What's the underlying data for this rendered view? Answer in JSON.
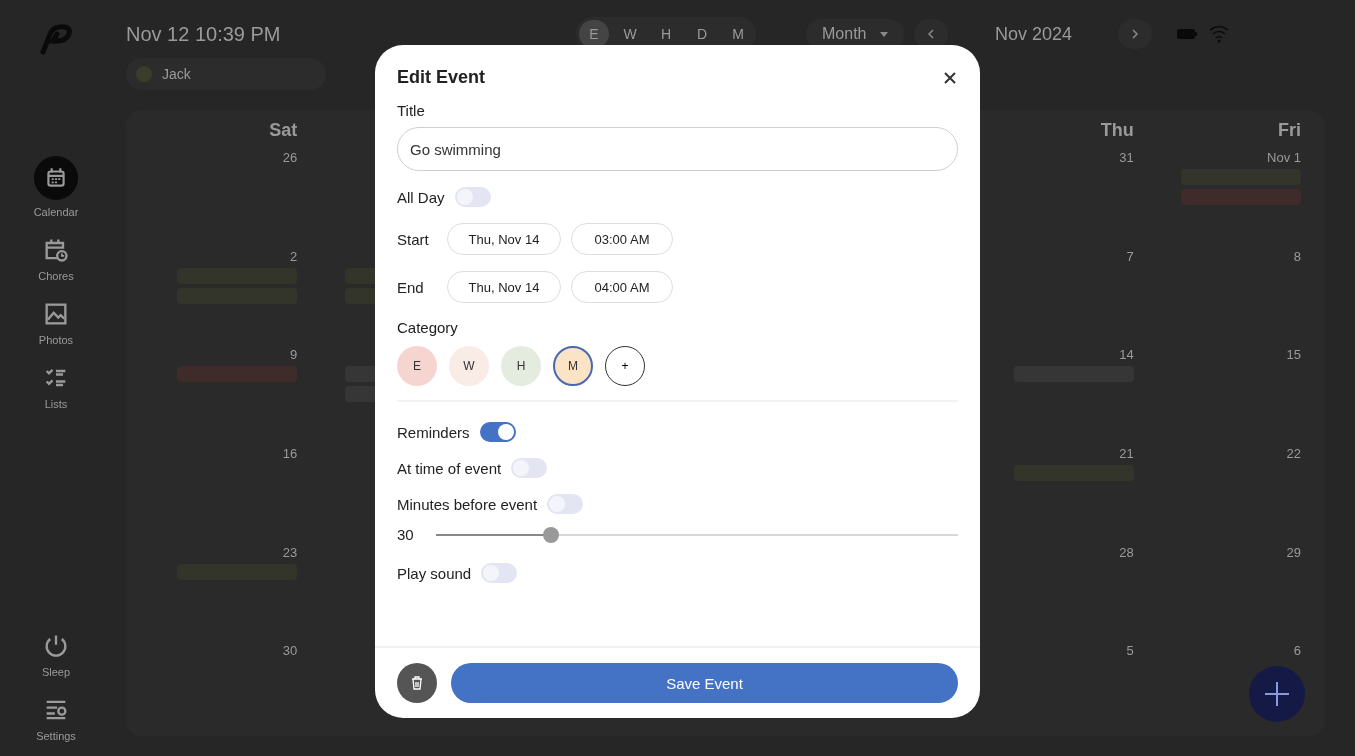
{
  "top_bar": {
    "clock": "Nov 12 10:39 PM",
    "filters": [
      {
        "label": "E",
        "selected": true
      },
      {
        "label": "W",
        "selected": false
      },
      {
        "label": "H",
        "selected": false
      },
      {
        "label": "D",
        "selected": false
      },
      {
        "label": "M",
        "selected": false
      }
    ],
    "view": "Month",
    "month": "Nov 2024",
    "profile": "Jack"
  },
  "sidebar": {
    "items": [
      {
        "kind": "calendar",
        "label": "Calendar",
        "selected": true
      },
      {
        "kind": "chores",
        "label": "Chores",
        "selected": false
      },
      {
        "kind": "photos",
        "label": "Photos",
        "selected": false
      },
      {
        "kind": "lists",
        "label": "Lists",
        "selected": false
      }
    ],
    "bottom_items": [
      {
        "kind": "sleep",
        "label": "Sleep",
        "selected": false
      },
      {
        "kind": "settings",
        "label": "Settings",
        "selected": false
      }
    ]
  },
  "calendar": {
    "columns": [
      {
        "weekday": "Sat",
        "days": [
          {
            "number": "26"
          },
          {
            "number": "2",
            "events": [
              {
                "color": "#33352a"
              },
              {
                "color": "#33352a"
              }
            ]
          },
          {
            "number": "9",
            "events": [
              {
                "color": "#402b2b"
              }
            ]
          },
          {
            "number": "16"
          },
          {
            "number": "23",
            "events": [
              {
                "color": "#33352a"
              }
            ]
          },
          {
            "number": "30"
          }
        ]
      },
      {
        "days_from_second_week": [
          {
            "events": [
              {
                "color": "#33352a"
              },
              {
                "color": "#33352a"
              }
            ]
          },
          {
            "events": [
              {
                "color": "#363636"
              },
              {
                "color": "#363636"
              }
            ]
          }
        ]
      },
      {},
      {},
      {},
      {
        "weekday": "Thu",
        "days": [
          {
            "number": "31"
          },
          {
            "number": "7"
          },
          {
            "number": "14",
            "events": [
              {
                "color": "#363636"
              }
            ]
          },
          {
            "number": "21",
            "events": [
              {
                "color": "#33352a"
              }
            ]
          },
          {
            "number": "28"
          },
          {
            "number": "5"
          }
        ]
      },
      {
        "weekday": "Fri",
        "days": [
          {
            "number": "Nov 1",
            "events": [
              {
                "color": "#33352a"
              },
              {
                "color": "#402b2b"
              }
            ]
          },
          {
            "number": "8"
          },
          {
            "number": "15"
          },
          {
            "number": "22"
          },
          {
            "number": "29"
          },
          {
            "number": "6"
          }
        ]
      }
    ]
  },
  "dialog": {
    "title": "Edit Event",
    "title_label": "Title",
    "title_value": "Go swimming",
    "all_day": {
      "label": "All Day",
      "on": false
    },
    "start": {
      "label": "Start",
      "date": "Thu, Nov 14",
      "time": "03:00 AM"
    },
    "end": {
      "label": "End",
      "date": "Thu, Nov 14",
      "time": "04:00 AM"
    },
    "category_label": "Category",
    "categories": [
      {
        "label": "E",
        "color": "#f6d5d0",
        "selected": false
      },
      {
        "label": "W",
        "color": "#f9ece6",
        "selected": false
      },
      {
        "label": "H",
        "color": "#e4ebdf",
        "selected": false
      },
      {
        "label": "M",
        "color": "#fbe3c6",
        "selected": true
      }
    ],
    "add_category": "+",
    "reminders": {
      "label": "Reminders",
      "on": true
    },
    "reminder_options": [
      {
        "kind": "toggle",
        "label": "At time of event",
        "on": false
      },
      {
        "kind": "toggle",
        "label": "Minutes before event",
        "on": false
      },
      {
        "kind": "slider",
        "value": "30",
        "level": 0.22
      },
      {
        "kind": "toggle",
        "label": "Play sound",
        "on": false
      }
    ],
    "save": "Save Event"
  }
}
